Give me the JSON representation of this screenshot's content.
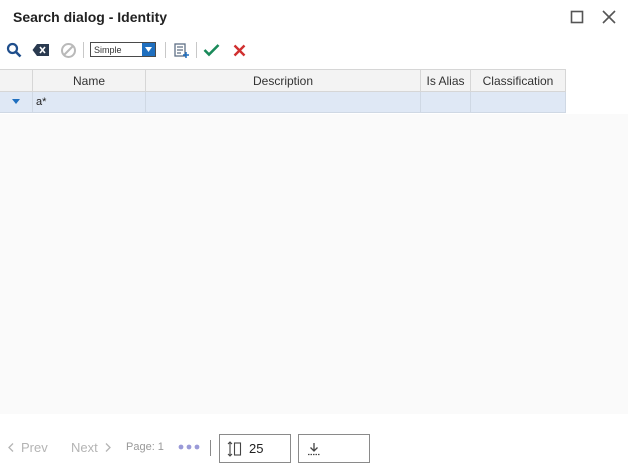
{
  "window": {
    "title": "Search dialog - Identity",
    "maximize_icon": "maximize-icon",
    "close_icon": "close-icon"
  },
  "toolbar": {
    "search_icon": "search-icon",
    "clear_icon": "backspace-icon",
    "cancel_icon": "ban-icon",
    "mode_value": "Simple",
    "mode_options": [
      "Simple"
    ],
    "list_icon": "list-add-icon",
    "accept_icon": "check-icon",
    "reject_icon": "x-icon",
    "accent_color": "#1f6fbf",
    "accept_color": "#1a8a5a",
    "reject_color": "#d03030"
  },
  "grid": {
    "columns": [
      "",
      "Name",
      "Description",
      "Is Alias",
      "Classification"
    ],
    "rows": [
      {
        "indicator_icon": "caret-down-icon",
        "name": "a*",
        "description": "",
        "is_alias": "",
        "classification": ""
      }
    ],
    "row_color": "#dfe8f5"
  },
  "pager": {
    "prev_label": "Prev",
    "next_label": "Next",
    "page_label": "Page: 1",
    "more_icon": "more-dots-icon",
    "page_size": "25",
    "page_size_icon": "page-size-icon",
    "export_icon": "download-icon"
  }
}
